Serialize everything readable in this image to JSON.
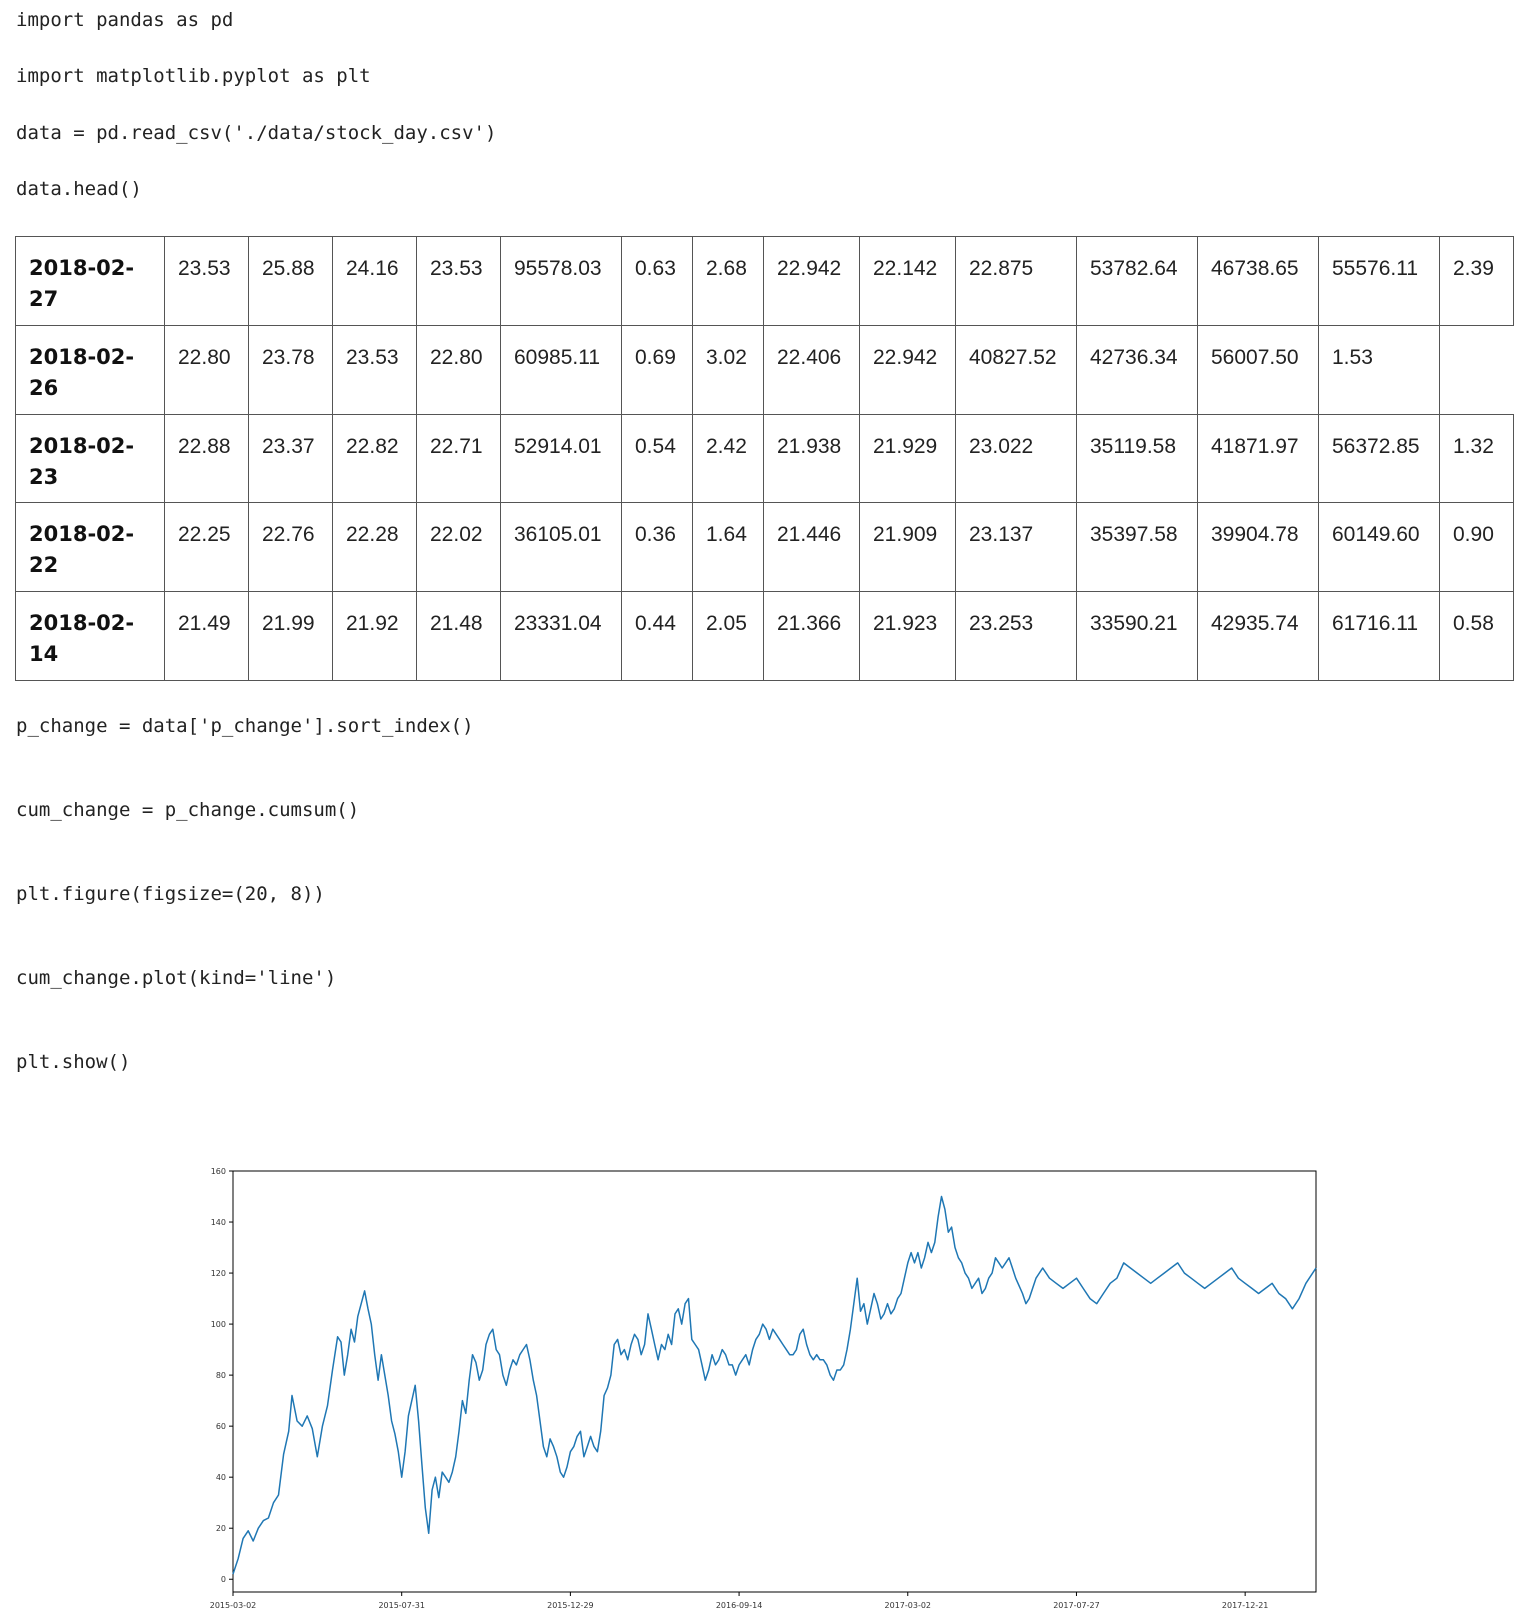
{
  "code": {
    "line1": "import pandas as pd",
    "line2": "import matplotlib.pyplot as plt",
    "line3": "data = pd.read_csv('./data/stock_day.csv')",
    "line4": "data.head()",
    "line5": "p_change = data['p_change'].sort_index()",
    "line6": "cum_change = p_change.cumsum()",
    "line7": "plt.figure(figsize=(20, 8))",
    "line8": "cum_change.plot(kind='line')",
    "line9": "plt.show()"
  },
  "table": {
    "rows": [
      {
        "index": "2018-02-27",
        "cells": [
          "23.53",
          "25.88",
          "24.16",
          "23.53",
          "95578.03",
          "0.63",
          "2.68",
          "22.942",
          "22.142",
          "22.875",
          "53782.64",
          "46738.65",
          "55576.11",
          "2.39"
        ]
      },
      {
        "index": "2018-02-26",
        "cells": [
          "22.80",
          "23.78",
          "23.53",
          "22.80",
          "60985.11",
          "0.69",
          "3.02",
          "22.406",
          "22.942",
          "40827.52",
          "42736.34",
          "56007.50",
          "1.53",
          ""
        ]
      },
      {
        "index": "2018-02-23",
        "cells": [
          "22.88",
          "23.37",
          "22.82",
          "22.71",
          "52914.01",
          "0.54",
          "2.42",
          "21.938",
          "21.929",
          "23.022",
          "35119.58",
          "41871.97",
          "56372.85",
          "1.32"
        ]
      },
      {
        "index": "2018-02-22",
        "cells": [
          "22.25",
          "22.76",
          "22.28",
          "22.02",
          "36105.01",
          "0.36",
          "1.64",
          "21.446",
          "21.909",
          "23.137",
          "35397.58",
          "39904.78",
          "60149.60",
          "0.90"
        ]
      },
      {
        "index": "2018-02-14",
        "cells": [
          "21.49",
          "21.99",
          "21.92",
          "21.48",
          "23331.04",
          "0.44",
          "2.05",
          "21.366",
          "21.923",
          "23.253",
          "33590.21",
          "42935.74",
          "61716.11",
          "0.58"
        ]
      }
    ]
  },
  "chart_data": {
    "type": "line",
    "line_color": "#1f77b4",
    "grid": false,
    "ylim": [
      -5,
      160
    ],
    "yticks": [
      "0",
      "20",
      "40",
      "60",
      "80",
      "100",
      "120",
      "140",
      "160"
    ],
    "xticks": [
      "2015-03-02",
      "2015-07-31",
      "2015-12-29",
      "2016-09-14",
      "2017-03-02",
      "2017-07-27",
      "2017-12-21"
    ],
    "x_index_range": [
      0,
      642
    ],
    "xtick_positions": [
      0,
      100,
      200,
      300,
      400,
      500,
      600
    ],
    "series": [
      {
        "points": [
          [
            0,
            2
          ],
          [
            3,
            8
          ],
          [
            6,
            16
          ],
          [
            9,
            19
          ],
          [
            12,
            15
          ],
          [
            15,
            20
          ],
          [
            18,
            23
          ],
          [
            21,
            24
          ],
          [
            24,
            30
          ],
          [
            27,
            33
          ],
          [
            30,
            49
          ],
          [
            33,
            58
          ],
          [
            35,
            72
          ],
          [
            38,
            62
          ],
          [
            41,
            60
          ],
          [
            44,
            64
          ],
          [
            47,
            59
          ],
          [
            50,
            48
          ],
          [
            53,
            60
          ],
          [
            56,
            68
          ],
          [
            59,
            82
          ],
          [
            62,
            95
          ],
          [
            64,
            93
          ],
          [
            66,
            80
          ],
          [
            68,
            88
          ],
          [
            70,
            98
          ],
          [
            72,
            93
          ],
          [
            74,
            103
          ],
          [
            76,
            108
          ],
          [
            78,
            113
          ],
          [
            80,
            106
          ],
          [
            82,
            100
          ],
          [
            84,
            88
          ],
          [
            86,
            78
          ],
          [
            88,
            88
          ],
          [
            90,
            80
          ],
          [
            92,
            72
          ],
          [
            94,
            62
          ],
          [
            96,
            57
          ],
          [
            98,
            50
          ],
          [
            100,
            40
          ],
          [
            102,
            50
          ],
          [
            104,
            64
          ],
          [
            106,
            70
          ],
          [
            108,
            76
          ],
          [
            110,
            62
          ],
          [
            112,
            45
          ],
          [
            114,
            28
          ],
          [
            116,
            18
          ],
          [
            118,
            35
          ],
          [
            120,
            40
          ],
          [
            122,
            32
          ],
          [
            124,
            42
          ],
          [
            126,
            40
          ],
          [
            128,
            38
          ],
          [
            130,
            42
          ],
          [
            132,
            48
          ],
          [
            134,
            58
          ],
          [
            136,
            70
          ],
          [
            138,
            65
          ],
          [
            140,
            78
          ],
          [
            142,
            88
          ],
          [
            144,
            85
          ],
          [
            146,
            78
          ],
          [
            148,
            82
          ],
          [
            150,
            92
          ],
          [
            152,
            96
          ],
          [
            154,
            98
          ],
          [
            156,
            90
          ],
          [
            158,
            88
          ],
          [
            160,
            80
          ],
          [
            162,
            76
          ],
          [
            164,
            82
          ],
          [
            166,
            86
          ],
          [
            168,
            84
          ],
          [
            170,
            88
          ],
          [
            172,
            90
          ],
          [
            174,
            92
          ],
          [
            176,
            86
          ],
          [
            178,
            78
          ],
          [
            180,
            72
          ],
          [
            182,
            62
          ],
          [
            184,
            52
          ],
          [
            186,
            48
          ],
          [
            188,
            55
          ],
          [
            190,
            52
          ],
          [
            192,
            48
          ],
          [
            194,
            42
          ],
          [
            196,
            40
          ],
          [
            198,
            44
          ],
          [
            200,
            50
          ],
          [
            202,
            52
          ],
          [
            204,
            56
          ],
          [
            206,
            58
          ],
          [
            208,
            48
          ],
          [
            210,
            52
          ],
          [
            212,
            56
          ],
          [
            214,
            52
          ],
          [
            216,
            50
          ],
          [
            218,
            58
          ],
          [
            220,
            72
          ],
          [
            222,
            75
          ],
          [
            224,
            80
          ],
          [
            226,
            92
          ],
          [
            228,
            94
          ],
          [
            230,
            88
          ],
          [
            232,
            90
          ],
          [
            234,
            86
          ],
          [
            236,
            92
          ],
          [
            238,
            96
          ],
          [
            240,
            94
          ],
          [
            242,
            88
          ],
          [
            244,
            92
          ],
          [
            246,
            104
          ],
          [
            248,
            98
          ],
          [
            250,
            92
          ],
          [
            252,
            86
          ],
          [
            254,
            92
          ],
          [
            256,
            90
          ],
          [
            258,
            96
          ],
          [
            260,
            92
          ],
          [
            262,
            104
          ],
          [
            264,
            106
          ],
          [
            266,
            100
          ],
          [
            268,
            108
          ],
          [
            270,
            110
          ],
          [
            272,
            94
          ],
          [
            274,
            92
          ],
          [
            276,
            90
          ],
          [
            278,
            84
          ],
          [
            280,
            78
          ],
          [
            282,
            82
          ],
          [
            284,
            88
          ],
          [
            286,
            84
          ],
          [
            288,
            86
          ],
          [
            290,
            90
          ],
          [
            292,
            88
          ],
          [
            294,
            84
          ],
          [
            296,
            84
          ],
          [
            298,
            80
          ],
          [
            300,
            84
          ],
          [
            302,
            86
          ],
          [
            304,
            88
          ],
          [
            306,
            84
          ],
          [
            308,
            90
          ],
          [
            310,
            94
          ],
          [
            312,
            96
          ],
          [
            314,
            100
          ],
          [
            316,
            98
          ],
          [
            318,
            94
          ],
          [
            320,
            98
          ],
          [
            322,
            96
          ],
          [
            324,
            94
          ],
          [
            326,
            92
          ],
          [
            328,
            90
          ],
          [
            330,
            88
          ],
          [
            332,
            88
          ],
          [
            334,
            90
          ],
          [
            336,
            96
          ],
          [
            338,
            98
          ],
          [
            340,
            92
          ],
          [
            342,
            88
          ],
          [
            344,
            86
          ],
          [
            346,
            88
          ],
          [
            348,
            86
          ],
          [
            350,
            86
          ],
          [
            352,
            84
          ],
          [
            354,
            80
          ],
          [
            356,
            78
          ],
          [
            358,
            82
          ],
          [
            360,
            82
          ],
          [
            362,
            84
          ],
          [
            364,
            90
          ],
          [
            366,
            98
          ],
          [
            368,
            108
          ],
          [
            370,
            118
          ],
          [
            372,
            105
          ],
          [
            374,
            108
          ],
          [
            376,
            100
          ],
          [
            378,
            106
          ],
          [
            380,
            112
          ],
          [
            382,
            108
          ],
          [
            384,
            102
          ],
          [
            386,
            104
          ],
          [
            388,
            108
          ],
          [
            390,
            104
          ],
          [
            392,
            106
          ],
          [
            394,
            110
          ],
          [
            396,
            112
          ],
          [
            398,
            118
          ],
          [
            400,
            124
          ],
          [
            402,
            128
          ],
          [
            404,
            124
          ],
          [
            406,
            128
          ],
          [
            408,
            122
          ],
          [
            410,
            126
          ],
          [
            412,
            132
          ],
          [
            414,
            128
          ],
          [
            416,
            132
          ],
          [
            418,
            142
          ],
          [
            420,
            150
          ],
          [
            422,
            145
          ],
          [
            424,
            136
          ],
          [
            426,
            138
          ],
          [
            428,
            130
          ],
          [
            430,
            126
          ],
          [
            432,
            124
          ],
          [
            434,
            120
          ],
          [
            436,
            118
          ],
          [
            438,
            114
          ],
          [
            440,
            116
          ],
          [
            442,
            118
          ],
          [
            444,
            112
          ],
          [
            446,
            114
          ],
          [
            448,
            118
          ],
          [
            450,
            120
          ],
          [
            452,
            126
          ],
          [
            454,
            124
          ],
          [
            456,
            122
          ],
          [
            458,
            124
          ],
          [
            460,
            126
          ],
          [
            462,
            122
          ],
          [
            464,
            118
          ],
          [
            466,
            115
          ],
          [
            468,
            112
          ],
          [
            470,
            108
          ],
          [
            472,
            110
          ],
          [
            474,
            114
          ],
          [
            476,
            118
          ],
          [
            478,
            120
          ],
          [
            480,
            122
          ],
          [
            484,
            118
          ],
          [
            488,
            116
          ],
          [
            492,
            114
          ],
          [
            496,
            116
          ],
          [
            500,
            118
          ],
          [
            504,
            114
          ],
          [
            508,
            110
          ],
          [
            512,
            108
          ],
          [
            516,
            112
          ],
          [
            520,
            116
          ],
          [
            524,
            118
          ],
          [
            528,
            124
          ],
          [
            532,
            122
          ],
          [
            536,
            120
          ],
          [
            540,
            118
          ],
          [
            544,
            116
          ],
          [
            548,
            118
          ],
          [
            552,
            120
          ],
          [
            556,
            122
          ],
          [
            560,
            124
          ],
          [
            564,
            120
          ],
          [
            568,
            118
          ],
          [
            572,
            116
          ],
          [
            576,
            114
          ],
          [
            580,
            116
          ],
          [
            584,
            118
          ],
          [
            588,
            120
          ],
          [
            592,
            122
          ],
          [
            596,
            118
          ],
          [
            600,
            116
          ],
          [
            604,
            114
          ],
          [
            608,
            112
          ],
          [
            612,
            114
          ],
          [
            616,
            116
          ],
          [
            620,
            112
          ],
          [
            624,
            110
          ],
          [
            628,
            106
          ],
          [
            632,
            110
          ],
          [
            636,
            116
          ],
          [
            642,
            122
          ]
        ]
      }
    ]
  }
}
